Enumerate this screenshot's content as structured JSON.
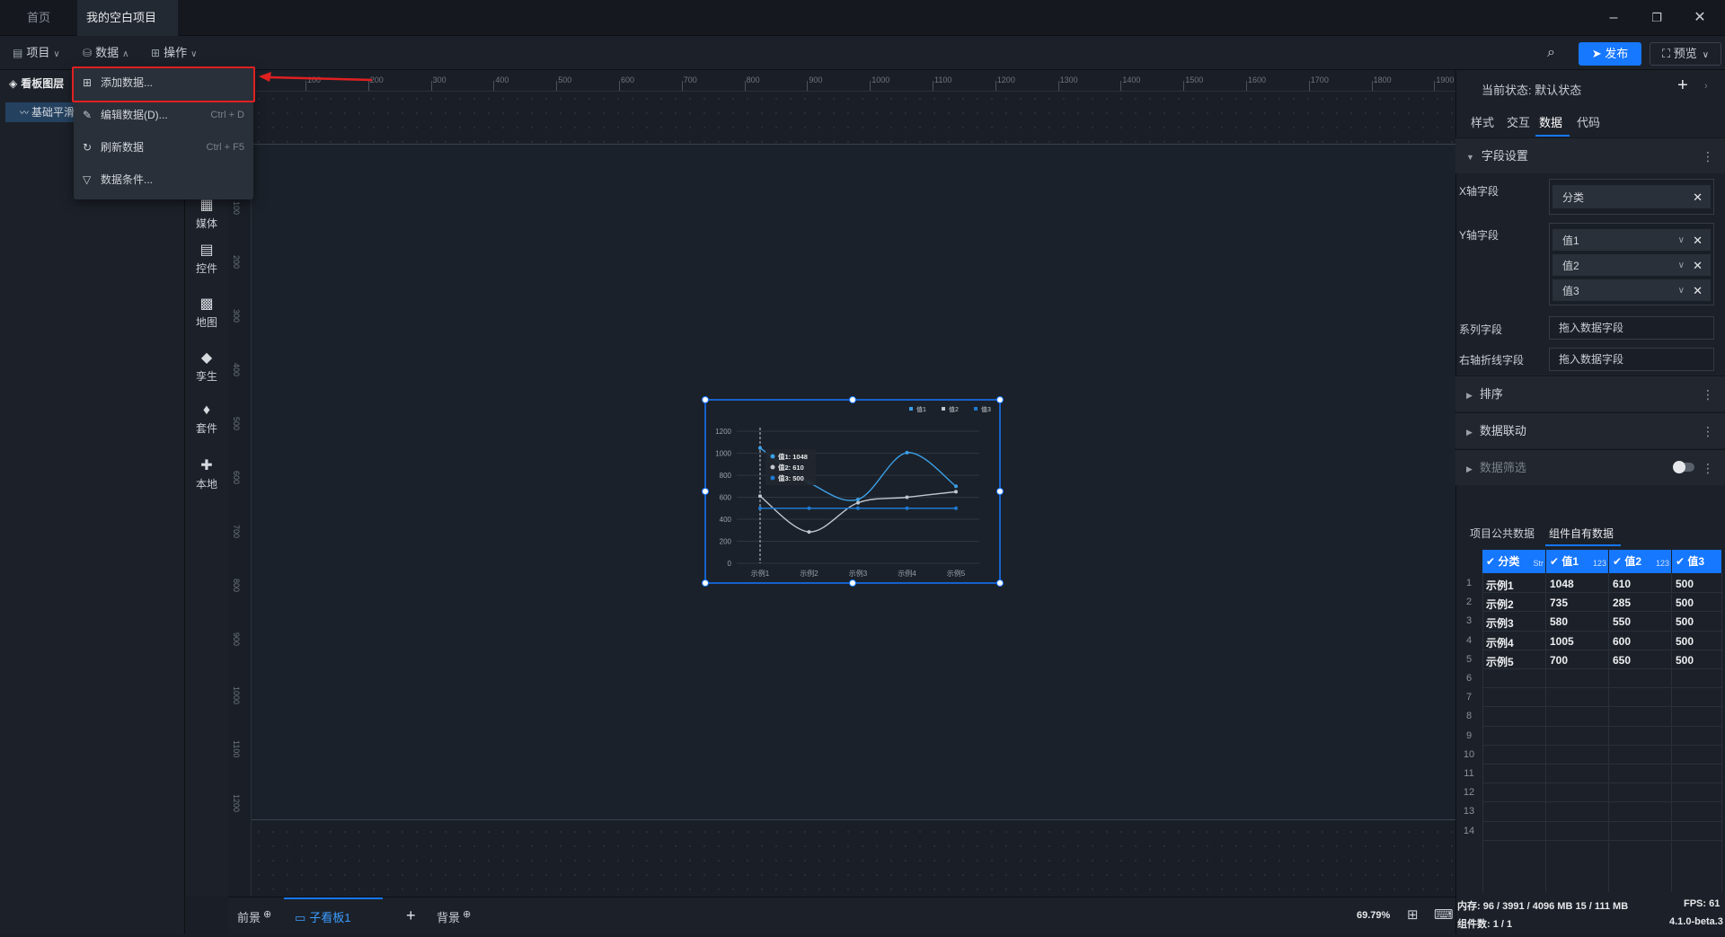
{
  "titlebar": {
    "tabs": [
      {
        "label": "首页"
      },
      {
        "label": "我的空白项目"
      }
    ]
  },
  "menubar": {
    "project": "项目",
    "data": "数据",
    "operate": "操作",
    "publish": "发布",
    "preview": "预览"
  },
  "dropdown": {
    "items": [
      {
        "label": "添加数据...",
        "shortcut": ""
      },
      {
        "label": "编辑数据(D)...",
        "shortcut": "Ctrl + D"
      },
      {
        "label": "刷新数据",
        "shortcut": "Ctrl + F5"
      },
      {
        "label": "数据条件...",
        "shortcut": ""
      }
    ]
  },
  "leftpanel": {
    "layers_title": "看板图层",
    "layer_item": "基础平滑"
  },
  "tools": [
    {
      "label": "媒体",
      "icon": "media-icon"
    },
    {
      "label": "控件",
      "icon": "widget-icon"
    },
    {
      "label": "地图",
      "icon": "map-icon"
    },
    {
      "label": "孪生",
      "icon": "twin-icon"
    },
    {
      "label": "套件",
      "icon": "kit-icon"
    },
    {
      "label": "本地",
      "icon": "local-icon"
    }
  ],
  "ruler": {
    "h": [
      "100",
      "200",
      "300",
      "400",
      "500",
      "600",
      "700",
      "800",
      "900",
      "1000",
      "1100",
      "1200",
      "1300",
      "1400",
      "1500",
      "1600",
      "1700",
      "1800",
      "1900"
    ],
    "v": [
      "100",
      "200",
      "300",
      "400",
      "500",
      "600",
      "700",
      "800",
      "900",
      "1000",
      "1100",
      "1200"
    ]
  },
  "bottombar": {
    "foreground": "前景",
    "board": "子看板1",
    "background": "背景",
    "zoom": "69.79%"
  },
  "rightpanel": {
    "state_label": "当前状态:",
    "state_value": "默认状态",
    "tabs": [
      "样式",
      "交互",
      "数据",
      "代码"
    ],
    "field_settings": "字段设置",
    "x_label": "X轴字段",
    "x_value": "分类",
    "y_label": "Y轴字段",
    "y_values": [
      "值1",
      "值2",
      "值3"
    ],
    "series_label": "系列字段",
    "series_placeholder": "拖入数据字段",
    "right_label": "右轴折线字段",
    "right_placeholder": "拖入数据字段",
    "sort": "排序",
    "linkage": "数据联动",
    "filter": "数据筛选",
    "data_tabs": [
      "项目公共数据",
      "组件自有数据"
    ]
  },
  "table": {
    "headers": [
      {
        "label": "分类",
        "type": "Str"
      },
      {
        "label": "值1",
        "type": "123"
      },
      {
        "label": "值2",
        "type": "123"
      },
      {
        "label": "值3",
        "type": ""
      }
    ],
    "rows": [
      [
        "示例1",
        "1048",
        "610",
        "500"
      ],
      [
        "示例2",
        "735",
        "285",
        "500"
      ],
      [
        "示例3",
        "580",
        "550",
        "500"
      ],
      [
        "示例4",
        "1005",
        "600",
        "500"
      ],
      [
        "示例5",
        "700",
        "650",
        "500"
      ]
    ],
    "row_numbers": [
      "1",
      "2",
      "3",
      "4",
      "5",
      "6",
      "7",
      "8",
      "9",
      "10",
      "11",
      "12",
      "13",
      "14"
    ]
  },
  "status": {
    "memory": "内存: 96 / 3991 / 4096 MB  15 / 111 MB",
    "fps": "FPS: 61",
    "components": "组件数: 1 / 1",
    "version": "4.1.0-beta.3"
  },
  "chart_data": {
    "type": "line",
    "categories": [
      "示例1",
      "示例2",
      "示例3",
      "示例4",
      "示例5"
    ],
    "series": [
      {
        "name": "值1",
        "values": [
          1048,
          735,
          580,
          1005,
          700
        ],
        "color": "#3ba0e6"
      },
      {
        "name": "值2",
        "values": [
          610,
          285,
          550,
          600,
          650
        ],
        "color": "#c0c6d0"
      },
      {
        "name": "值3",
        "values": [
          500,
          500,
          500,
          500,
          500
        ],
        "color": "#1f78d1"
      }
    ],
    "ylim": [
      0,
      1200
    ],
    "yticks": [
      "0",
      "200",
      "400",
      "600",
      "800",
      "1000",
      "1200"
    ],
    "legend": "top-right",
    "tooltip": [
      {
        "name": "值1",
        "value": "1048"
      },
      {
        "name": "值2",
        "value": "610"
      },
      {
        "name": "值3",
        "value": "500"
      }
    ]
  }
}
